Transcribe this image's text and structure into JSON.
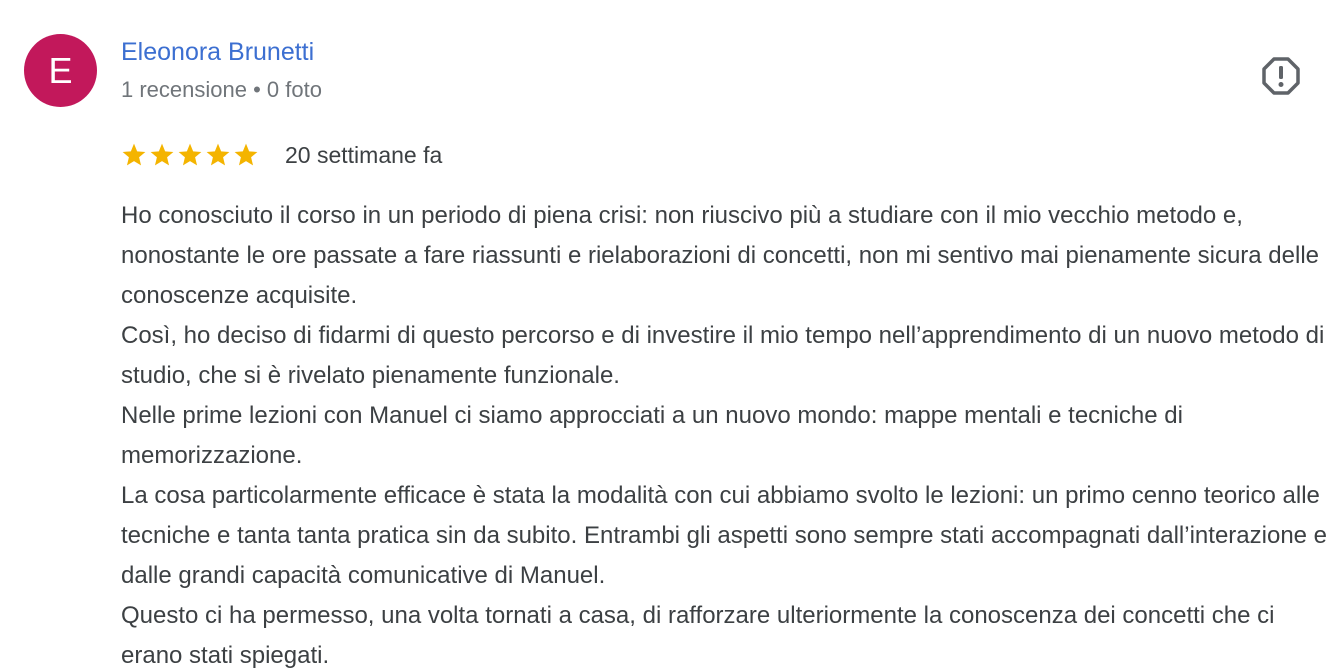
{
  "author": {
    "initial": "E",
    "avatar_color": "#c2185b",
    "name": "Eleonora Brunetti",
    "meta": "1 recensione • 0 foto",
    "name_color": "#3c6fd1"
  },
  "flag_icon": "flag-icon",
  "rating": {
    "stars": 5,
    "max": 5,
    "star_color": "#f4b400",
    "date": "20 settimane fa"
  },
  "review": {
    "paragraphs": [
      "Ho conosciuto il corso in un periodo di piena crisi: non riuscivo più a studiare con il mio vecchio metodo e, nonostante le ore passate a fare riassunti e rielaborazioni di concetti, non mi sentivo mai pienamente sicura delle conoscenze acquisite.",
      "Così, ho deciso di fidarmi di questo percorso e di investire il mio tempo nell’apprendimento di un nuovo metodo di studio, che si è rivelato pienamente funzionale.",
      "Nelle prime lezioni con Manuel ci siamo approcciati a un nuovo mondo: mappe mentali e tecniche di memorizzazione.",
      "La cosa particolarmente efficace è stata la modalità con cui abbiamo svolto le lezioni: un primo cenno teorico alle tecniche e tanta tanta pratica sin da subito. Entrambi gli aspetti sono sempre stati accompagnati dall’interazione e dalle grandi capacità comunicative di Manuel.",
      "Questo ci ha permesso, una volta tornati a casa, di rafforzare ulteriormente la conoscenza dei concetti che ci erano stati spiegati."
    ]
  }
}
